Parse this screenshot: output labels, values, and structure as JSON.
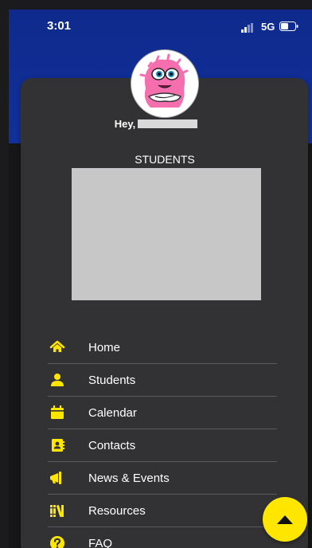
{
  "status_bar": {
    "time": "3:01",
    "network": "5G"
  },
  "profile": {
    "greeting": "Hey,"
  },
  "students_section": {
    "title": "STUDENTS"
  },
  "menu": {
    "items": [
      {
        "label": "Home",
        "icon": "home-icon"
      },
      {
        "label": "Students",
        "icon": "person-icon"
      },
      {
        "label": "Calendar",
        "icon": "calendar-icon"
      },
      {
        "label": "Contacts",
        "icon": "contacts-icon"
      },
      {
        "label": "News & Events",
        "icon": "megaphone-icon"
      },
      {
        "label": "Resources",
        "icon": "books-icon"
      },
      {
        "label": "FAQ",
        "icon": "question-icon"
      }
    ]
  },
  "colors": {
    "header_blue": "#11309b",
    "panel": "#323234",
    "accent_yellow": "#ffe600"
  }
}
